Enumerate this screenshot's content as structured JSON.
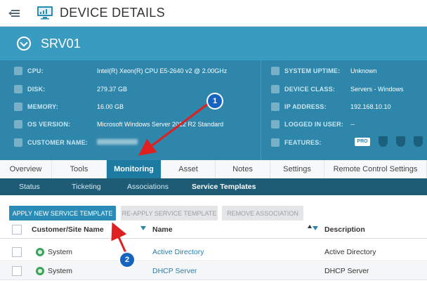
{
  "header": {
    "title": "DEVICE DETAILS"
  },
  "device": {
    "name": "SRV01"
  },
  "properties_left": [
    {
      "label": "CPU:",
      "value": "Intel(R) Xeon(R) CPU E5-2640 v2 @ 2.00GHz"
    },
    {
      "label": "DISK:",
      "value": "279.37 GB"
    },
    {
      "label": "MEMORY:",
      "value": "16.00 GB"
    },
    {
      "label": "OS VERSION:",
      "value": "Microsoft Windows Server 2012 R2 Standard"
    },
    {
      "label": "CUSTOMER NAME:",
      "value": ""
    }
  ],
  "properties_right": [
    {
      "label": "SYSTEM UPTIME:",
      "value": "Unknown"
    },
    {
      "label": "DEVICE CLASS:",
      "value": "Servers - Windows"
    },
    {
      "label": "IP ADDRESS:",
      "value": "192.168.10.10"
    },
    {
      "label": "LOGGED IN USER:",
      "value": "--"
    },
    {
      "label": "FEATURES:",
      "value": ""
    }
  ],
  "features": {
    "pro_label": "PRO"
  },
  "tabs": [
    "Overview",
    "Tools",
    "Monitoring",
    "Asset",
    "Notes",
    "Settings",
    "Remote Control Settings"
  ],
  "active_tab": "Monitoring",
  "subtabs": [
    "Status",
    "Ticketing",
    "Associations",
    "Service Templates"
  ],
  "active_subtab": "Service Templates",
  "actions": {
    "apply": "APPLY NEW SERVICE TEMPLATE",
    "reapply": "RE-APPLY SERVICE TEMPLATE",
    "remove": "REMOVE ASSOCIATION"
  },
  "table": {
    "columns": [
      "Customer/Site Name",
      "Name",
      "Description"
    ],
    "rows": [
      {
        "site": "System",
        "name": "Active Directory",
        "description": "Active Directory"
      },
      {
        "site": "System",
        "name": "DHCP Server",
        "description": "DHCP Server"
      }
    ]
  },
  "annotations": {
    "callout_1": "1",
    "callout_2": "2"
  },
  "colors": {
    "header_teal": "#3a9bc0",
    "panel_teal": "#2e86aa",
    "subnav": "#1e5b74",
    "arrow_red": "#e02020",
    "callout_blue": "#1565c0"
  }
}
